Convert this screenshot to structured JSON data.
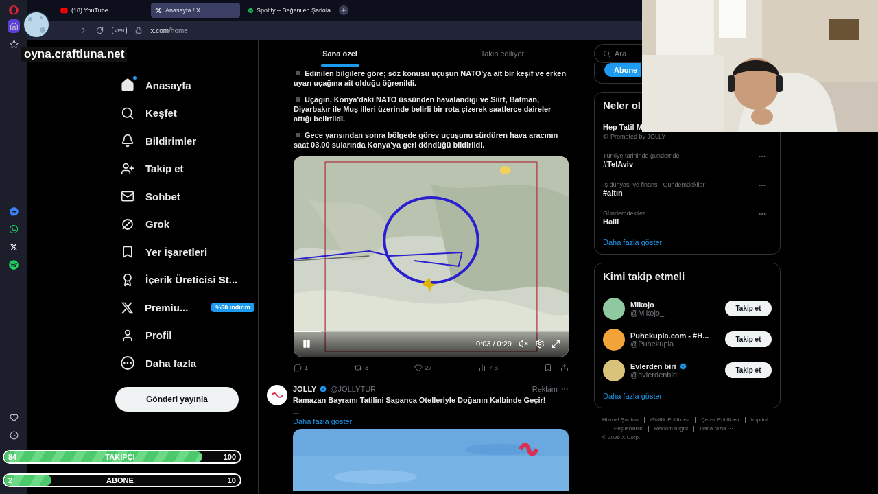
{
  "browser": {
    "tabs": [
      {
        "kind": "youtube",
        "title": "(18) YouTube",
        "selected": false
      },
      {
        "kind": "x",
        "title": "Anasayfa / X",
        "selected": true
      },
      {
        "kind": "spotify",
        "title": "Spotify – Beğenilen Şarkıla",
        "selected": false
      }
    ],
    "vpn": "VPN",
    "url": {
      "host": "x.com",
      "path": "/home"
    }
  },
  "opera_sidebar": {
    "top": [
      {
        "kind": "home",
        "selected": true
      },
      {
        "kind": "star",
        "selected": false
      }
    ],
    "apps": [
      {
        "kind": "messenger",
        "selected": false
      },
      {
        "kind": "whatsapp",
        "selected": false
      },
      {
        "kind": "x",
        "selected": false
      },
      {
        "kind": "spotify",
        "selected": false
      }
    ],
    "bottom": [
      {
        "kind": "heart",
        "selected": false
      },
      {
        "kind": "clock",
        "selected": false
      }
    ]
  },
  "stream_overlay": {
    "site": "oyna.craftluna.net",
    "goals": [
      {
        "count": "84",
        "label": "TAKIPÇI",
        "target": "100",
        "level": 0.84
      },
      {
        "count": "2",
        "label": "ABONE",
        "target": "10",
        "level": 0.2
      }
    ]
  },
  "nav": {
    "items": [
      {
        "kind": "home",
        "label": "Anasayfa",
        "selected": true
      },
      {
        "kind": "explore",
        "label": "Keşfet",
        "selected": false
      },
      {
        "kind": "notifications",
        "label": "Bildirimler",
        "selected": false
      },
      {
        "kind": "follow",
        "label": "Takip et",
        "selected": false
      },
      {
        "kind": "chat",
        "label": "Sohbet",
        "selected": false
      },
      {
        "kind": "grok",
        "label": "Grok",
        "selected": false
      },
      {
        "kind": "bookmarks",
        "label": "Yer İşaretleri",
        "selected": false
      },
      {
        "kind": "creator",
        "label": "İçerik Üreticisi St...",
        "selected": false
      },
      {
        "kind": "premium",
        "label": "Premiu...",
        "badge": "%50 indirim",
        "selected": false
      },
      {
        "kind": "profile",
        "label": "Profil",
        "selected": false
      },
      {
        "kind": "more",
        "label": "Daha fazla",
        "selected": false
      }
    ],
    "post_button": "Gönderi yayınla"
  },
  "feed": {
    "tabs": [
      {
        "label": "Sana özel",
        "selected": true
      },
      {
        "label": "Takip ediliyor",
        "selected": false
      }
    ],
    "post": {
      "paragraphs": [
        "Edinilen bilgilere göre; söz konusu uçuşun NATO'ya ait bir keşif ve erken uyarı uçağına ait olduğu öğrenildi.",
        "Uçağın, Konya'daki NATO üssünden havalandığı ve Siirt, Batman, Diyarbakır ile Muş illeri üzerinde belirli bir rota çizerek saatlerce daireler attığı belirtildi.",
        "Gece yarısından sonra bölgede görev uçuşunu sürdüren hava aracının saat 03.00 sularında Konya'ya geri döndüğü bildirildi."
      ],
      "video": {
        "kind": "picture",
        "time": "0:03 / 0:29",
        "level": 0.1,
        "playing": true
      },
      "actions": [
        {
          "kind": "reply",
          "count": "1"
        },
        {
          "kind": "repost",
          "count": "3"
        },
        {
          "kind": "like",
          "count": "27"
        },
        {
          "kind": "views",
          "count": "7 B"
        }
      ]
    },
    "ad": {
      "name": "JOLLY",
      "verified": true,
      "handle": "@JOLLYTUR",
      "label": "Reklam",
      "text": "Ramazan Bayramı Tatilini Sapanca Otelleriyle Doğanın Kalbinde Geçir!",
      "ellipsis": "...",
      "more": "Daha fazla göster"
    }
  },
  "right": {
    "search": {
      "placeholder": "Ara"
    },
    "premium_button": "Abone",
    "trends": {
      "title": "Neler ol",
      "items": [
        {
          "kind": "promoted",
          "title": "Hep Tatil M",
          "meta": "Promoted by JOLLY"
        },
        {
          "kind": "trend",
          "meta": "Türkiye tarihinde gündemde",
          "title": "#TelAviv"
        },
        {
          "kind": "trend",
          "meta": "İş dünyası ve finans · Gündemdekiler",
          "title": "#altın"
        },
        {
          "kind": "trend",
          "meta": "Gündemdekiler",
          "title": "Halil"
        }
      ],
      "more": "Daha fazla göster"
    },
    "who_to_follow": {
      "title": "Kimi takip etmeli",
      "users": [
        {
          "name": "Mikojo",
          "handle": "@Mikojo_",
          "verified": false,
          "color": "#8fc9a0",
          "button": "Takip et"
        },
        {
          "name": "Puhekupla.com - #H...",
          "handle": "@Puhekupla",
          "verified": false,
          "color": "#f2a33a",
          "button": "Takip et"
        },
        {
          "name": "Evlerden biri",
          "handle": "@evlerdenbiri",
          "verified": true,
          "color": "#d9c27a",
          "button": "Takip et"
        }
      ],
      "more": "Daha fazla göster"
    },
    "footer": {
      "links": [
        "Hizmet Şartları",
        "Gizlilik Politikası",
        "Çerez Politikası",
        "Imprint",
        "Erişilebilirlik",
        "Reklam bilgisi",
        "Daha fazla ···"
      ],
      "copyright": "© 2026 X Corp."
    }
  }
}
